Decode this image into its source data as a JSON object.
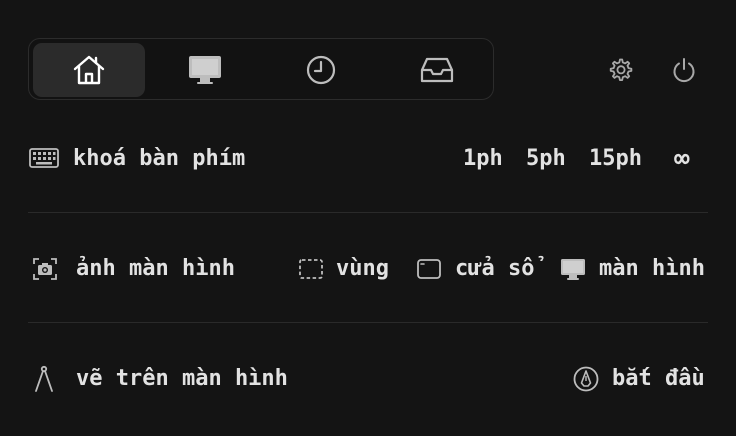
{
  "tabs": [
    {
      "icon": "home-icon",
      "active": true
    },
    {
      "icon": "monitor-icon",
      "active": false
    },
    {
      "icon": "clock-icon",
      "active": false
    },
    {
      "icon": "inbox-icon",
      "active": false
    }
  ],
  "top_actions": [
    {
      "icon": "gear-icon"
    },
    {
      "icon": "power-icon"
    }
  ],
  "keyboard_lock": {
    "icon": "keyboard-icon",
    "label": "khoá bàn phím",
    "durations": [
      "1ph",
      "5ph",
      "15ph",
      "∞"
    ]
  },
  "screenshot": {
    "icon": "camera-icon",
    "label": "ảnh màn hình",
    "options": [
      {
        "icon": "region-icon",
        "label": "vùng"
      },
      {
        "icon": "window-icon",
        "label": "cửa sổ"
      },
      {
        "icon": "display-icon",
        "label": "màn hình"
      }
    ]
  },
  "draw": {
    "icon": "compass-icon",
    "label": "vẽ trên màn hình",
    "start_icon": "pen-circle-icon",
    "start_label": "bắt đầu"
  },
  "colors": {
    "background": "#141414",
    "text": "#e2e2e2",
    "active_tab": "#2b2b2b",
    "icon": "#bdbdbd"
  }
}
